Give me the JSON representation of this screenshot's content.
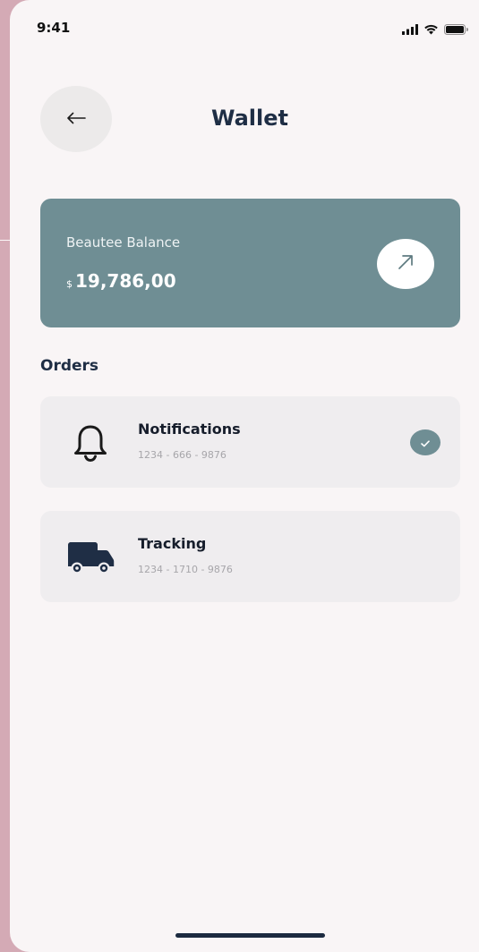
{
  "status_bar": {
    "time": "9:41",
    "icons": [
      "signal-icon",
      "wifi-icon",
      "battery-icon"
    ]
  },
  "header": {
    "title": "Wallet",
    "back_icon": "arrow-left-icon"
  },
  "balance": {
    "label": "Beautee Balance",
    "currency": "$",
    "amount": "19,786,00",
    "action_icon": "arrow-up-right-icon"
  },
  "orders": {
    "title": "Orders",
    "items": [
      {
        "title": "Notifications",
        "subtitle": "1234 - 666 - 9876",
        "icon": "bell-icon",
        "checked": true
      },
      {
        "title": "Tracking",
        "subtitle": "1234 - 1710 - 9876",
        "icon": "truck-icon",
        "checked": false
      }
    ]
  },
  "colors": {
    "accent": "#6f8e94",
    "title_text": "#1f2e45",
    "background_outer": "#d4aab5",
    "screen_background": "#f9f5f6",
    "card_background": "#efedef"
  }
}
